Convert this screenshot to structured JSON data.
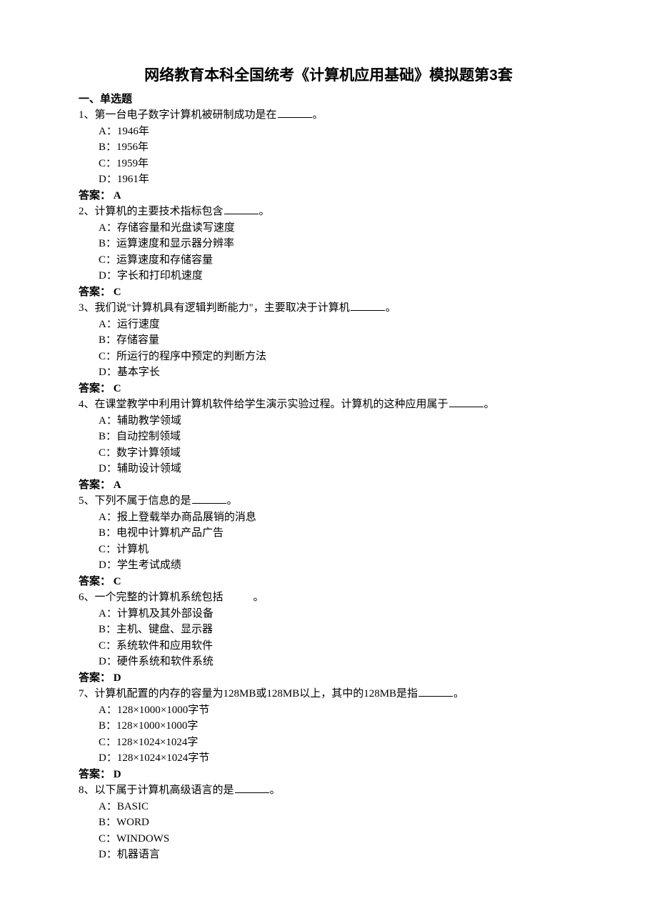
{
  "title": "网络教育本科全国统考《计算机应用基础》模拟题第3套",
  "section_header": "一、单选题",
  "answer_label_prefix": "答案：",
  "option_labels": [
    "A：",
    "B：",
    "C：",
    "D："
  ],
  "questions": [
    {
      "num": "1、",
      "stem_pre": "第一台电子数字计算机被研制成功是在",
      "stem_post": "。",
      "options": [
        "1946年",
        "1956年",
        "1959年",
        "1961年"
      ],
      "answer": "A"
    },
    {
      "num": "2、",
      "stem_pre": "计算机的主要技术指标包含",
      "stem_post": "。",
      "options": [
        "存储容量和光盘读写速度",
        "运算速度和显示器分辨率",
        "运算速度和存储容量",
        "字长和打印机速度"
      ],
      "answer": "C"
    },
    {
      "num": "3、",
      "stem_pre": "我们说\"计算机具有逻辑判断能力\"，主要取决于计算机",
      "stem_post": "。",
      "options": [
        "运行速度",
        "存储容量",
        "所运行的程序中预定的判断方法",
        "基本字长"
      ],
      "answer": "C"
    },
    {
      "num": "4、",
      "stem_pre": "在课堂教学中利用计算机软件给学生演示实验过程。计算机的这种应用属于",
      "stem_post": "。",
      "options": [
        "辅助教学领域",
        "自动控制领域",
        "数字计算领域",
        "辅助设计领域"
      ],
      "answer": "A"
    },
    {
      "num": "5、",
      "stem_pre": "下列不属于信息的是",
      "stem_post": "。",
      "options": [
        "报上登载举办商品展销的消息",
        "电视中计算机产品广告",
        "计算机",
        "学生考试成绩"
      ],
      "answer": "C"
    },
    {
      "num": "6、",
      "stem_pre": "一个完整的计算机系统包括",
      "stem_post": "。",
      "blank_style": "wide",
      "options": [
        "计算机及其外部设备",
        "主机、键盘、显示器",
        "系统软件和应用软件",
        "硬件系统和软件系统"
      ],
      "answer": "D"
    },
    {
      "num": "7、",
      "stem_pre": "计算机配置的内存的容量为128MB或128MB以上，其中的128MB是指",
      "stem_post": "。",
      "options": [
        "128×1000×1000字节",
        "128×1000×1000字",
        "128×1024×1024字",
        "128×1024×1024字节"
      ],
      "answer": "D"
    },
    {
      "num": "8、",
      "stem_pre": "以下属于计算机高级语言的是",
      "stem_post": "。",
      "options": [
        "BASIC",
        "WORD",
        "WINDOWS",
        "机器语言"
      ],
      "answer": ""
    }
  ]
}
